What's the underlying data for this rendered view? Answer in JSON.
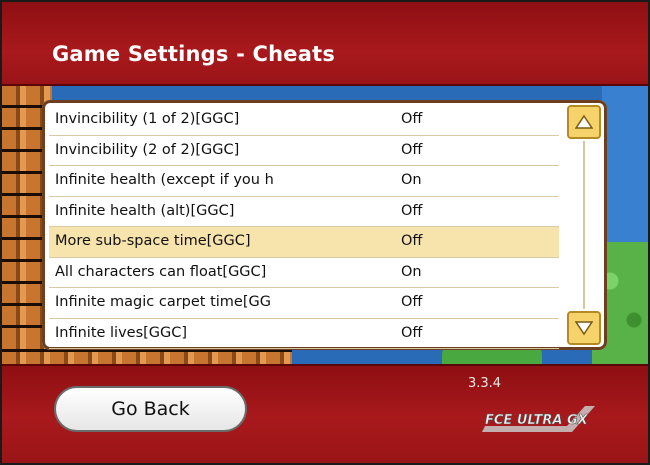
{
  "header": {
    "title": "Game Settings - Cheats"
  },
  "cheats": [
    {
      "name": "Invincibility (1 of 2)[GGC]",
      "state": "Off"
    },
    {
      "name": "Invincibility (2 of 2)[GGC]",
      "state": "Off"
    },
    {
      "name": "Infinite health (except if you h",
      "state": "On"
    },
    {
      "name": "Infinite health (alt)[GGC]",
      "state": "Off"
    },
    {
      "name": "More sub-space time[GGC]",
      "state": "Off",
      "selected": true
    },
    {
      "name": "All characters can float[GGC]",
      "state": "On"
    },
    {
      "name": "Infinite magic carpet time[GG",
      "state": "Off"
    },
    {
      "name": "Infinite lives[GGC]",
      "state": "Off"
    }
  ],
  "scroll": {
    "up_icon": "arrow-up-icon",
    "down_icon": "arrow-down-icon"
  },
  "footer": {
    "go_back_label": "Go Back",
    "version": "3.3.4",
    "logo_text": "FCE ULTRA GX"
  },
  "colors": {
    "bar_red": "#a8191c",
    "selected_row": "#f7e3ac",
    "scroll_button": "#f5d36a"
  }
}
